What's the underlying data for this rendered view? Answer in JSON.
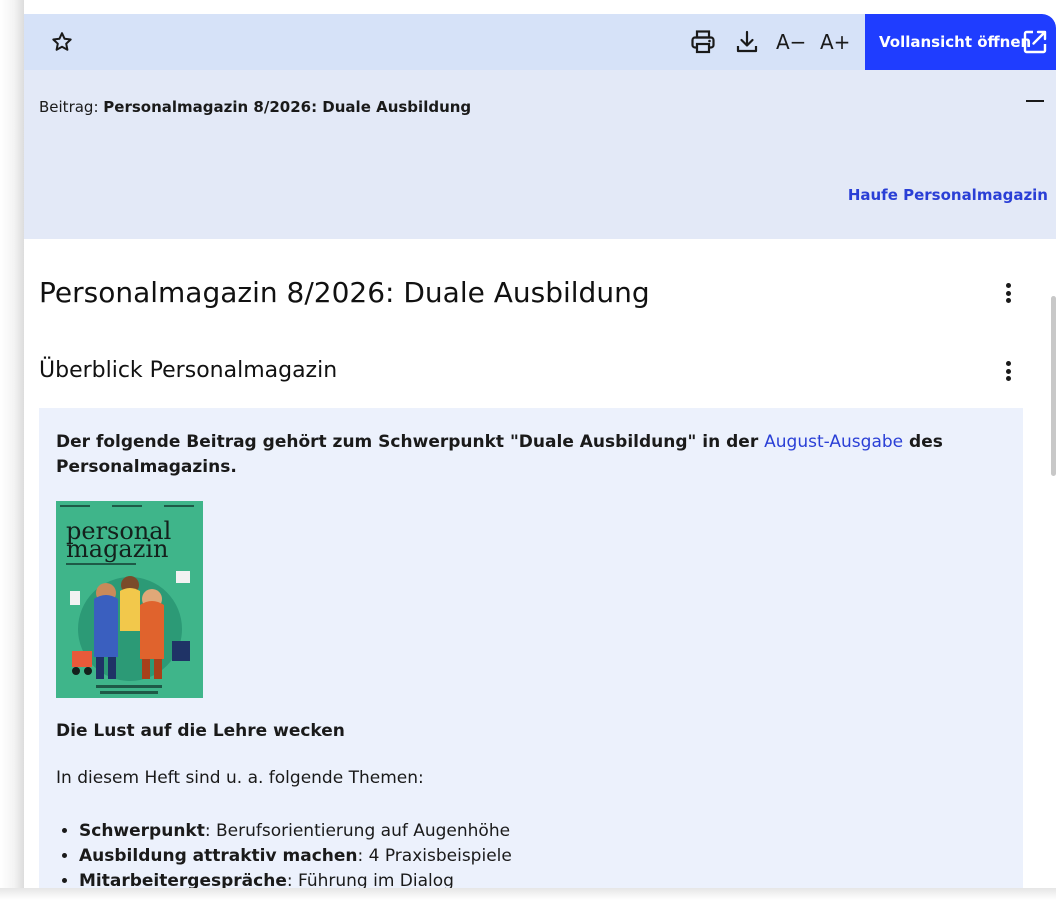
{
  "toolbar": {
    "font_decrease": "A−",
    "font_increase": "A+",
    "open_full_label": "Vollansicht öffnen"
  },
  "meta": {
    "breadcrumb_label": "Beitrag:",
    "breadcrumb_value": "Personalmagazin 8/2026: Duale Ausbildung",
    "source_link": "Haufe Personalmagazin"
  },
  "article": {
    "title": "Personalmagazin 8/2026: Duale Ausbildung",
    "section_title": "Überblick Personalmagazin",
    "intro_before": "Der folgende Beitrag gehört zum Schwerpunkt \"Duale Ausbildung\" in der ",
    "intro_link": "August-Ausgabe",
    "intro_after": " des Personalmagazins.",
    "cover_brand_line1": "personal",
    "cover_brand_line2": "magazin",
    "subheading": "Die Lust auf die Lehre wecken",
    "lead": "In diesem Heft sind u. a. folgende Themen:",
    "topics": [
      {
        "bold": "Schwerpunkt",
        "rest": ": Berufsorientierung auf Augenhöhe"
      },
      {
        "bold": "Ausbildung attraktiv machen",
        "rest": ": 4 Praxisbeispiele"
      },
      {
        "bold": "Mitarbeitergespräche",
        "rest": ": Führung im Dialog"
      }
    ]
  },
  "colors": {
    "toolbar_bg": "#d6e2f8",
    "meta_bg": "#e3e9f7",
    "accent": "#1f3dff",
    "link": "#2a3fd6",
    "content_bg": "#ecf1fc"
  },
  "icons": [
    "star-icon",
    "printer-icon",
    "download-icon",
    "external-link-icon",
    "kebab-menu-icon",
    "minus-icon"
  ]
}
